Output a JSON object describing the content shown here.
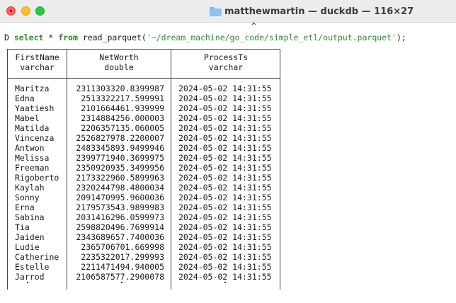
{
  "window": {
    "title": "matthewmartin — duckdb — 116×27"
  },
  "terminal": {
    "caret_marker": "^",
    "prompt_char": "D",
    "command": {
      "kw_select": "select",
      "star": " * ",
      "kw_from": "from",
      "func_open": " read_parquet(",
      "path": "'~/dream_machine/go_code/simple_etl/output.parquet'",
      "close": ");"
    }
  },
  "table": {
    "columns": [
      {
        "name": "FirstName",
        "type": "varchar"
      },
      {
        "name": "NetWorth",
        "type": "double"
      },
      {
        "name": "ProcessTs",
        "type": "varchar"
      }
    ],
    "rows": [
      [
        "Maritza",
        "2311303320.8399987",
        "2024-05-02 14:31:55"
      ],
      [
        "Edna",
        "2513322217.599991",
        "2024-05-02 14:31:55"
      ],
      [
        "Yaatiesh",
        "2101664461.939999",
        "2024-05-02 14:31:55"
      ],
      [
        "Mabel",
        "2314884256.000003",
        "2024-05-02 14:31:55"
      ],
      [
        "Matilda",
        "2206357135.060005",
        "2024-05-02 14:31:55"
      ],
      [
        "Vincenza",
        "2526827978.2200007",
        "2024-05-02 14:31:55"
      ],
      [
        "Antwon",
        "2483345893.9499946",
        "2024-05-02 14:31:55"
      ],
      [
        "Melissa",
        "2399771940.3699975",
        "2024-05-02 14:31:55"
      ],
      [
        "Freeman",
        "2350920935.3499956",
        "2024-05-02 14:31:55"
      ],
      [
        "Rigoberto",
        "2173322960.5899963",
        "2024-05-02 14:31:55"
      ],
      [
        "Kaylah",
        "2320244798.4800034",
        "2024-05-02 14:31:55"
      ],
      [
        "Sonny",
        "2091470995.9600036",
        "2024-05-02 14:31:55"
      ],
      [
        "Erna",
        "2179573543.9899983",
        "2024-05-02 14:31:55"
      ],
      [
        "Sabina",
        "2031416296.0599973",
        "2024-05-02 14:31:55"
      ],
      [
        "Tia",
        "2598820496.7699914",
        "2024-05-02 14:31:55"
      ],
      [
        "Jaiden",
        "2343689657.7400036",
        "2024-05-02 14:31:55"
      ],
      [
        "Ludie",
        "2365706701.669998",
        "2024-05-02 14:31:55"
      ],
      [
        "Catherine",
        "2235322017.299993",
        "2024-05-02 14:31:55"
      ],
      [
        "Estelle",
        "2211471494.940005",
        "2024-05-02 14:31:55"
      ],
      [
        "Jarrod",
        "2106587577.2900078",
        "2024-05-02 14:31:55"
      ]
    ]
  },
  "colors": {
    "titlebar_bg": "#ececec",
    "keyword_green": "#2e8b2e",
    "close_red": "#ff5f57",
    "minimize_yellow": "#febc2e",
    "maximize_green": "#28c840"
  }
}
